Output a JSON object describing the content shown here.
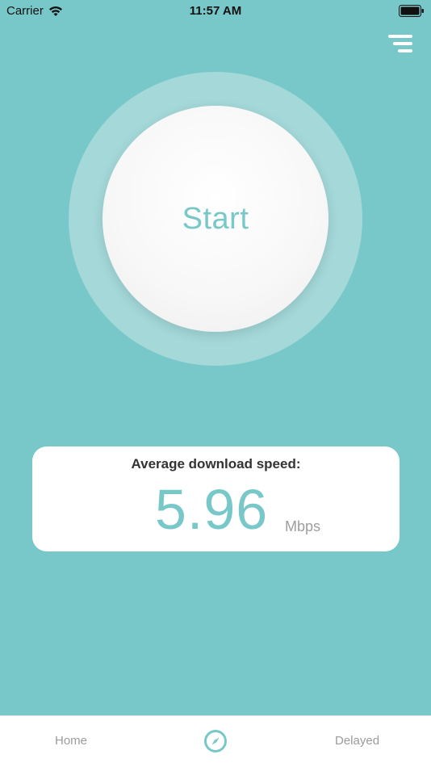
{
  "status_bar": {
    "carrier": "Carrier",
    "time": "11:57 AM",
    "wifi_icon": "wifi-icon",
    "battery_icon": "battery-icon"
  },
  "header": {
    "menu_icon": "menu-icon"
  },
  "start_button": {
    "label": "Start"
  },
  "speed_card": {
    "title": "Average download speed:",
    "value": "5.96",
    "unit": "Mbps"
  },
  "tab_bar": {
    "items": [
      {
        "label": "Home"
      },
      {
        "label": "",
        "icon": "compass-icon"
      },
      {
        "label": "Delayed"
      }
    ]
  },
  "colors": {
    "background": "#79c8c9",
    "ring": "#a4d8d9",
    "accent": "#79c8c9",
    "card": "#ffffff"
  }
}
